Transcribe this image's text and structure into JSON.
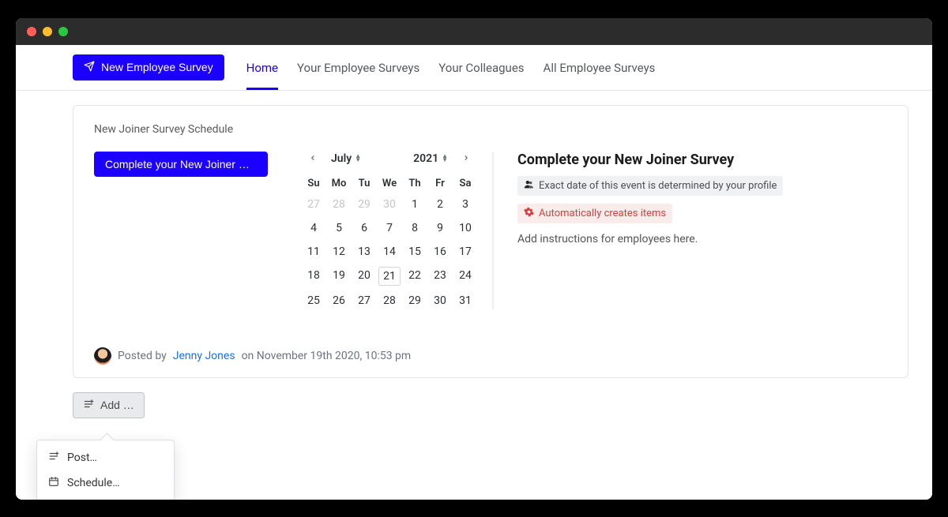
{
  "topbar": {
    "new_survey_label": "New Employee Survey",
    "tabs": [
      "Home",
      "Your Employee Surveys",
      "Your Colleagues",
      "All Employee Surveys"
    ],
    "active_tab_index": 0
  },
  "card": {
    "title": "New Joiner Survey Schedule",
    "primary_action_label": "Complete your New Joiner Su…",
    "posted_prefix": "Posted by ",
    "posted_author": "Jenny Jones",
    "posted_suffix": " on November 19th 2020, 10:53 pm"
  },
  "calendar": {
    "month_label": "July",
    "year_label": "2021",
    "dow": [
      "Su",
      "Mo",
      "Tu",
      "We",
      "Th",
      "Fr",
      "Sa"
    ],
    "days": [
      {
        "n": "27",
        "muted": true
      },
      {
        "n": "28",
        "muted": true
      },
      {
        "n": "29",
        "muted": true
      },
      {
        "n": "30",
        "muted": true
      },
      {
        "n": "1"
      },
      {
        "n": "2"
      },
      {
        "n": "3"
      },
      {
        "n": "4"
      },
      {
        "n": "5"
      },
      {
        "n": "6"
      },
      {
        "n": "7"
      },
      {
        "n": "8"
      },
      {
        "n": "9"
      },
      {
        "n": "10"
      },
      {
        "n": "11"
      },
      {
        "n": "12"
      },
      {
        "n": "13"
      },
      {
        "n": "14"
      },
      {
        "n": "15"
      },
      {
        "n": "16"
      },
      {
        "n": "17"
      },
      {
        "n": "18"
      },
      {
        "n": "19"
      },
      {
        "n": "20"
      },
      {
        "n": "21",
        "today": true
      },
      {
        "n": "22"
      },
      {
        "n": "23"
      },
      {
        "n": "24"
      },
      {
        "n": "25"
      },
      {
        "n": "26"
      },
      {
        "n": "27"
      },
      {
        "n": "28"
      },
      {
        "n": "29"
      },
      {
        "n": "30"
      },
      {
        "n": "31"
      }
    ]
  },
  "detail": {
    "title": "Complete your New Joiner Survey",
    "badge_profile": "Exact date of this event is determined by your profile",
    "badge_auto": "Automatically creates items",
    "body": "Add instructions for employees here."
  },
  "add_button_label": "Add …",
  "popover": {
    "post": "Post…",
    "schedule": "Schedule…"
  }
}
